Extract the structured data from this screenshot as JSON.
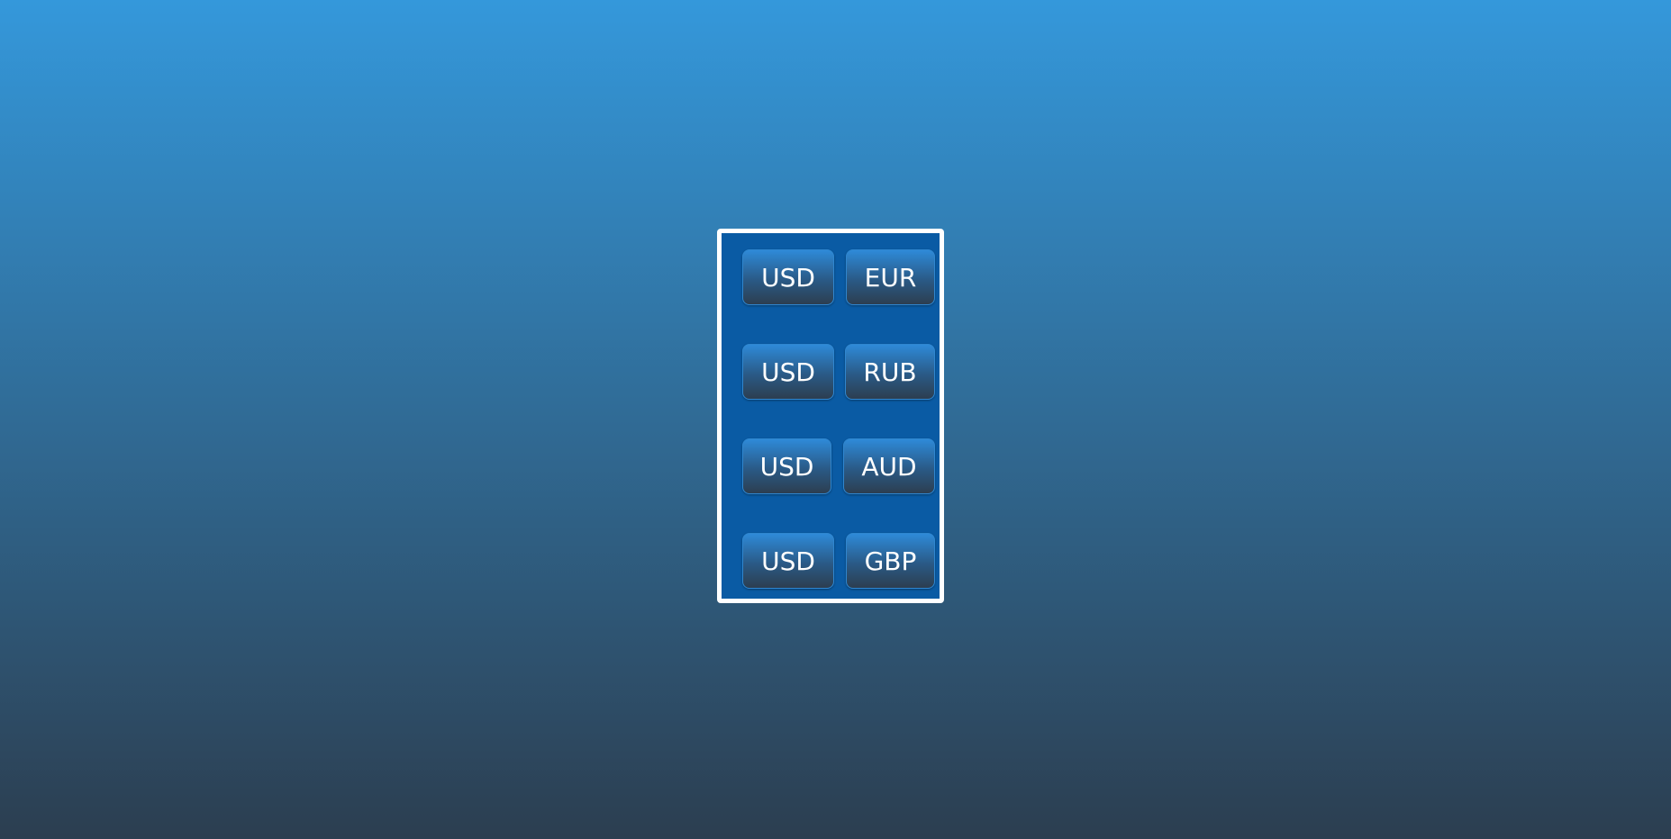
{
  "currency_pairs": [
    {
      "base": "USD",
      "quote": "EUR"
    },
    {
      "base": "USD",
      "quote": "RUB"
    },
    {
      "base": "USD",
      "quote": "AUD"
    },
    {
      "base": "USD",
      "quote": "GBP"
    }
  ],
  "colors": {
    "background_top": "#3498db",
    "background_bottom": "#2c3e50",
    "panel": "#0a5ba4",
    "panel_border": "#ffffff",
    "button_text": "#ffffff"
  }
}
